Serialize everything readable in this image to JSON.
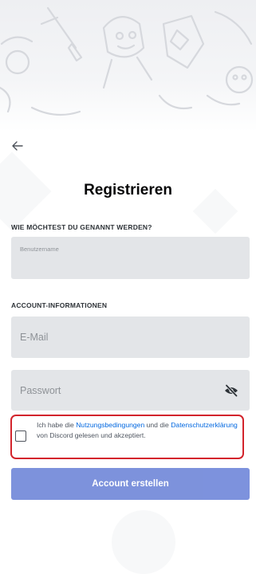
{
  "screen": {
    "back_icon": "arrow-left-icon",
    "title": "Registrieren"
  },
  "name_section": {
    "label": "WIE MÖCHTEST DU GENANNT WERDEN?",
    "username": {
      "value": "",
      "placeholder": "Benutzername"
    }
  },
  "account_section": {
    "label": "ACCOUNT-INFORMATIONEN",
    "email": {
      "value": "",
      "placeholder": "E-Mail"
    },
    "password": {
      "value": "",
      "placeholder": "Passwort",
      "visibility_icon": "eye-slash-icon"
    }
  },
  "terms": {
    "checked": false,
    "text_1": "Ich habe die ",
    "link_terms": "Nutzungsbedingungen",
    "text_2": " und die ",
    "link_privacy": "Datenschutzerklärung",
    "text_3": " von Discord gelesen und akzeptiert."
  },
  "submit_label": "Account erstellen",
  "colors": {
    "accent": "#7289da",
    "link": "#0067e0",
    "highlight_border": "#d3242c",
    "field_bg": "#e3e5e8"
  }
}
